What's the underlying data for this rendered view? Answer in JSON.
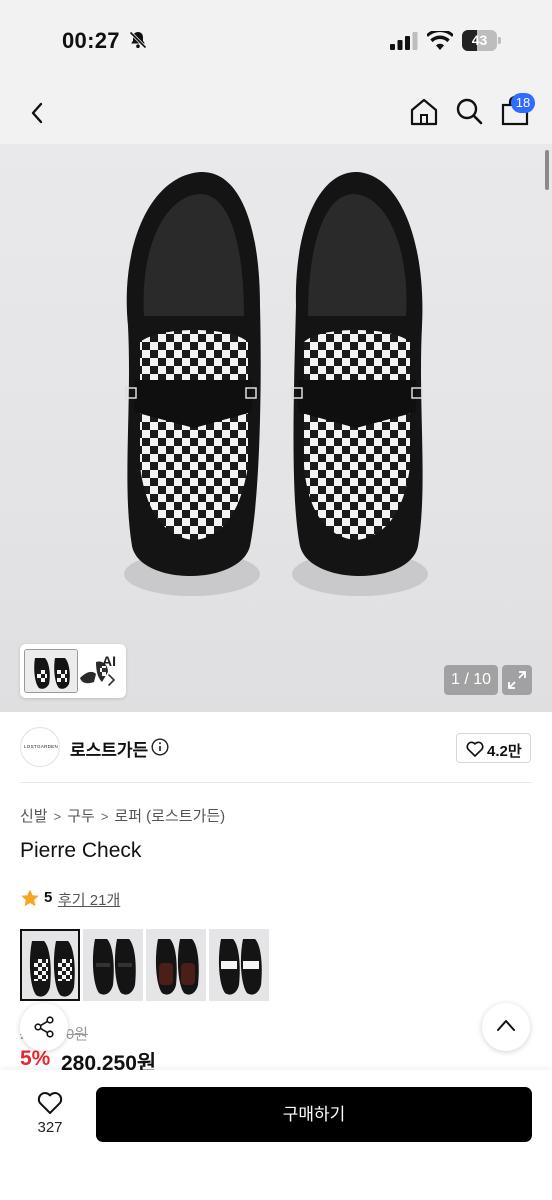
{
  "status_bar": {
    "time": "00:27",
    "battery_level": "43",
    "icons": [
      "bell-slash-icon",
      "cellular-signal-icon",
      "wifi-icon",
      "battery-icon"
    ]
  },
  "nav": {
    "cart_count": "18",
    "icons": [
      "back-chevron-icon",
      "home-icon",
      "search-icon",
      "shopping-bag-icon"
    ]
  },
  "gallery": {
    "ai_label": "AI",
    "counter": "1 / 10",
    "icons": [
      "expand-icon",
      "chevron-right-icon"
    ]
  },
  "brand": {
    "logo_text": "LOSTGARDEN",
    "name": "로스트가든",
    "likes": "4.2만",
    "icons": [
      "info-icon",
      "heart-outline-icon"
    ]
  },
  "breadcrumb": [
    "신발",
    "구두",
    "로퍼 (로스트가든)"
  ],
  "product": {
    "title": "Pierre Check",
    "rating": "5",
    "reviews_label": "후기 21개",
    "original_price": "295,000원",
    "discount": "5%",
    "price": "280,250원"
  },
  "variants": [
    {
      "name": "black-white-check",
      "selected": true
    },
    {
      "name": "black",
      "selected": false
    },
    {
      "name": "brown",
      "selected": false
    },
    {
      "name": "black-white-penny",
      "selected": false
    }
  ],
  "bottom_bar": {
    "wish_count": "327",
    "buy_label": "구매하기"
  },
  "colors": {
    "accent_blue": "#2f6bff",
    "discount_red": "#e8262e",
    "star_orange": "#f6a623",
    "button_black": "#000000"
  }
}
